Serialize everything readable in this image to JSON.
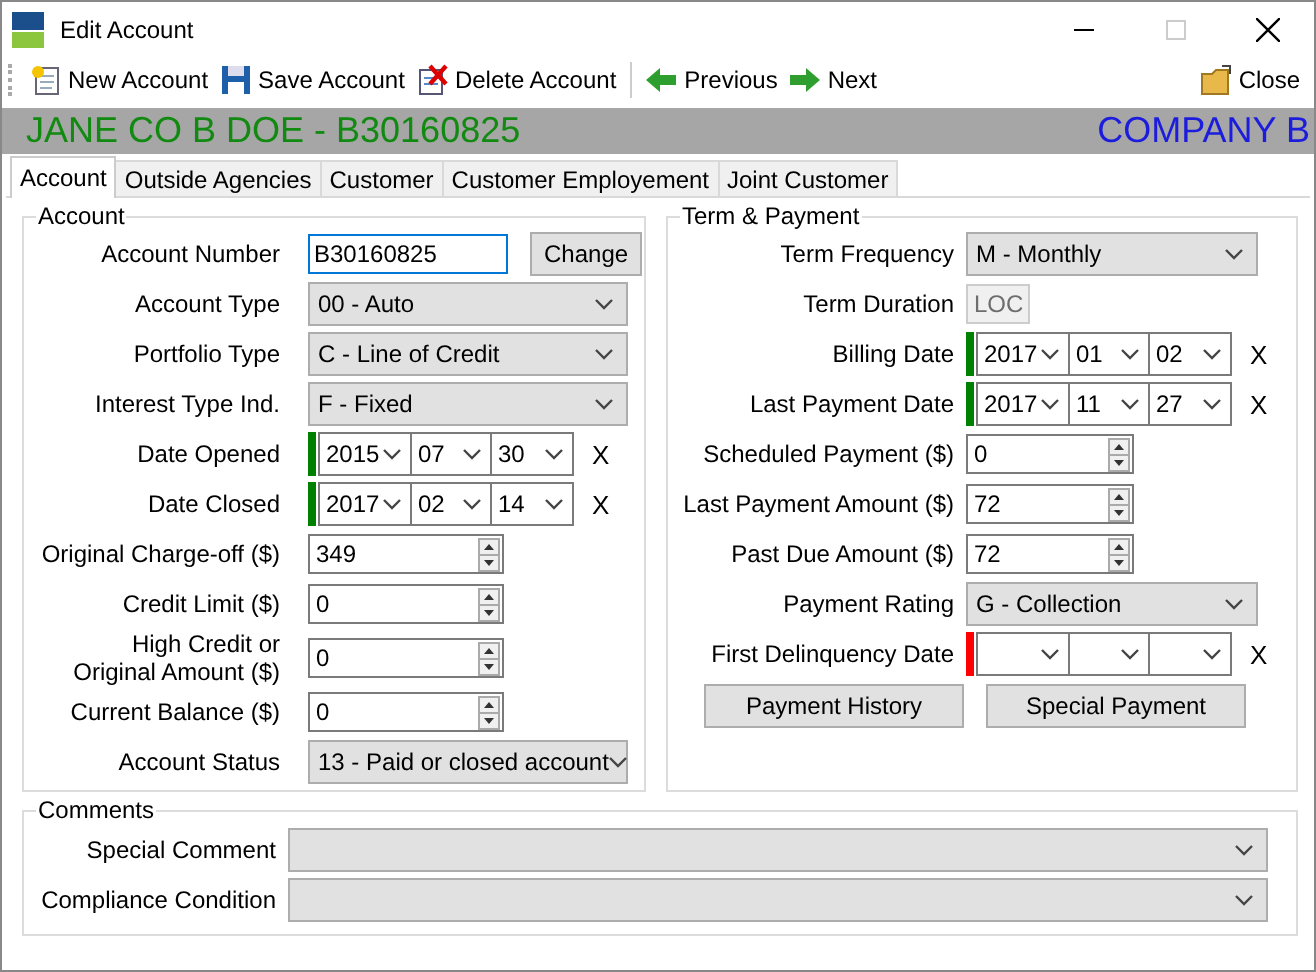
{
  "window": {
    "title": "Edit Account"
  },
  "toolbar": [
    {
      "kind": "new",
      "label": "New Account"
    },
    {
      "kind": "save",
      "label": "Save Account"
    },
    {
      "kind": "delete",
      "label": "Delete Account"
    },
    {
      "kind": "previous",
      "label": "Previous"
    },
    {
      "kind": "next",
      "label": "Next"
    },
    {
      "kind": "close",
      "label": "Close"
    }
  ],
  "header": {
    "name": "JANE CO B DOE - B30160825",
    "company": "COMPANY B"
  },
  "tabs": [
    {
      "label": "Account",
      "selected": true
    },
    {
      "label": "Outside Agencies",
      "selected": false
    },
    {
      "label": "Customer",
      "selected": false
    },
    {
      "label": "Customer Employement",
      "selected": false
    },
    {
      "label": "Joint Customer",
      "selected": false
    }
  ],
  "account": {
    "title": "Account",
    "fields": [
      {
        "kind": "text",
        "label": "Account Number",
        "value": "B30160825",
        "focused": true,
        "button": "Change"
      },
      {
        "kind": "select",
        "label": "Account Type",
        "value": "00 - Auto"
      },
      {
        "kind": "select",
        "label": "Portfolio Type",
        "value": "C - Line of Credit"
      },
      {
        "kind": "select",
        "label": "Interest Type Ind.",
        "value": "F - Fixed"
      },
      {
        "kind": "date",
        "label": "Date Opened",
        "color": "#008000",
        "year": "2015",
        "month": "07",
        "day": "30",
        "clear": "X"
      },
      {
        "kind": "date",
        "label": "Date Closed",
        "color": "#008000",
        "year": "2017",
        "month": "02",
        "day": "14",
        "clear": "X"
      },
      {
        "kind": "spin",
        "label": "Original Charge-off ($)",
        "value": "349"
      },
      {
        "kind": "spin",
        "label": "Credit Limit ($)",
        "value": "0"
      },
      {
        "kind": "spin",
        "label": "High Credit or\nOriginal Amount ($)",
        "value": "0"
      },
      {
        "kind": "spin",
        "label": "Current Balance ($)",
        "value": "0"
      },
      {
        "kind": "select",
        "label": "Account Status",
        "value": "13 - Paid or closed account"
      }
    ]
  },
  "term": {
    "title": "Term & Payment",
    "fields": [
      {
        "kind": "select",
        "label": "Term Frequency",
        "value": "M - Monthly"
      },
      {
        "kind": "readonly",
        "label": "Term Duration",
        "value": "LOC"
      },
      {
        "kind": "date",
        "label": "Billing Date",
        "color": "#008000",
        "year": "2017",
        "month": "01",
        "day": "02",
        "clear": "X"
      },
      {
        "kind": "date",
        "label": "Last Payment Date",
        "color": "#008000",
        "year": "2017",
        "month": "11",
        "day": "27",
        "clear": "X"
      },
      {
        "kind": "spin",
        "label": "Scheduled Payment ($)",
        "value": "0"
      },
      {
        "kind": "spin",
        "label": "Last Payment Amount ($)",
        "value": "72"
      },
      {
        "kind": "spin",
        "label": "Past Due Amount ($)",
        "value": "72"
      },
      {
        "kind": "select",
        "label": "Payment Rating",
        "value": "G - Collection"
      },
      {
        "kind": "date",
        "label": "First Delinquency Date",
        "color": "#ff0000",
        "clear": "X"
      }
    ],
    "buttons": [
      "Payment History",
      "Special Payment"
    ]
  },
  "comments": {
    "title": "Comments",
    "fields": [
      {
        "kind": "select",
        "label": "Special Comment"
      },
      {
        "kind": "select",
        "label": "Compliance Condition"
      }
    ]
  }
}
